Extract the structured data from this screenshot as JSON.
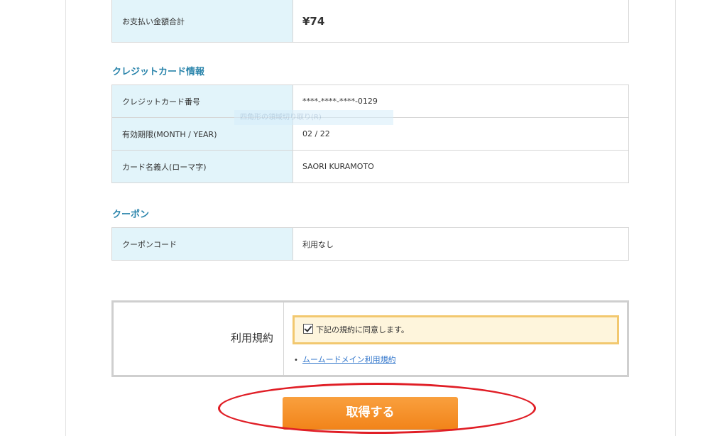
{
  "payment": {
    "total_label": "お支払い金額合計",
    "total_value": "¥74"
  },
  "credit_card": {
    "heading": "クレジットカード情報",
    "rows": [
      {
        "label": "クレジットカード番号",
        "value": "****-****-****-0129"
      },
      {
        "label": "有効期限(MONTH / YEAR)",
        "value": "02 / 22"
      },
      {
        "label": "カード名義人(ローマ字)",
        "value": "SAORI KURAMOTO"
      }
    ]
  },
  "coupon": {
    "heading": "クーポン",
    "rows": [
      {
        "label": "クーポンコード",
        "value": "利用なし"
      }
    ]
  },
  "overlay": {
    "text": "四角形の領域切り取り(R)"
  },
  "terms": {
    "label": "利用規約",
    "agree_text": "下記の規約に同意します。",
    "agree_checked": true,
    "link_text": "ムームードメイン利用規約",
    "bullet": "•"
  },
  "submit": {
    "label": "取得する"
  },
  "colors": {
    "accent_heading": "#2a84ab",
    "key_cell_bg": "#e2f4fa",
    "button_orange": "#f2841a",
    "highlight_red": "#e01e26",
    "agree_border": "#f2c86f"
  }
}
